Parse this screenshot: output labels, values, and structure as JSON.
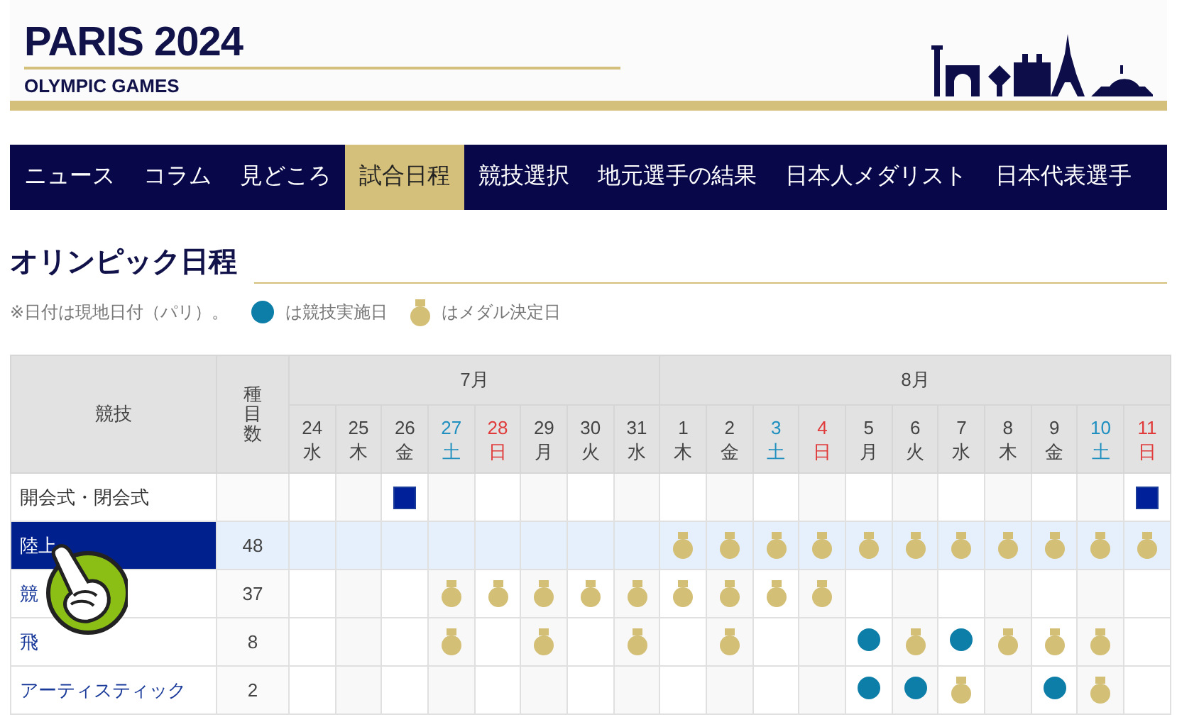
{
  "logo": {
    "title": "PARIS 2024",
    "subtitle": "OLYMPIC GAMES"
  },
  "nav": [
    {
      "label": "ニュース",
      "selected": false
    },
    {
      "label": "コラム",
      "selected": false
    },
    {
      "label": "見どころ",
      "selected": false
    },
    {
      "label": "試合日程",
      "selected": true
    },
    {
      "label": "競技選択",
      "selected": false
    },
    {
      "label": "地元選手の結果",
      "selected": false
    },
    {
      "label": "日本人メダリスト",
      "selected": false
    },
    {
      "label": "日本代表選手",
      "selected": false
    }
  ],
  "heading": "オリンピック日程",
  "legend": {
    "note": "※日付は現地日付（パリ）。",
    "dot_label": "は競技実施日",
    "medal_label": "はメダル決定日"
  },
  "table": {
    "sport_header": "競技",
    "count_header": "種目数",
    "months": [
      {
        "label": "7月",
        "days": [
          {
            "date": "24",
            "weekday": "水",
            "kind": "weekday"
          },
          {
            "date": "25",
            "weekday": "木",
            "kind": "weekday"
          },
          {
            "date": "26",
            "weekday": "金",
            "kind": "weekday"
          },
          {
            "date": "27",
            "weekday": "土",
            "kind": "saturday"
          },
          {
            "date": "28",
            "weekday": "日",
            "kind": "sunday"
          },
          {
            "date": "29",
            "weekday": "月",
            "kind": "weekday"
          },
          {
            "date": "30",
            "weekday": "火",
            "kind": "weekday"
          },
          {
            "date": "31",
            "weekday": "水",
            "kind": "weekday"
          }
        ]
      },
      {
        "label": "8月",
        "days": [
          {
            "date": "1",
            "weekday": "木",
            "kind": "weekday"
          },
          {
            "date": "2",
            "weekday": "金",
            "kind": "weekday"
          },
          {
            "date": "3",
            "weekday": "土",
            "kind": "saturday"
          },
          {
            "date": "4",
            "weekday": "日",
            "kind": "sunday"
          },
          {
            "date": "5",
            "weekday": "月",
            "kind": "weekday"
          },
          {
            "date": "6",
            "weekday": "火",
            "kind": "weekday"
          },
          {
            "date": "7",
            "weekday": "水",
            "kind": "weekday"
          },
          {
            "date": "8",
            "weekday": "木",
            "kind": "weekday"
          },
          {
            "date": "9",
            "weekday": "金",
            "kind": "weekday"
          },
          {
            "date": "10",
            "weekday": "土",
            "kind": "saturday"
          },
          {
            "date": "11",
            "weekday": "日",
            "kind": "sunday"
          }
        ]
      }
    ],
    "rows": [
      {
        "sport": "開会式・閉会式",
        "link": false,
        "selected": false,
        "cells": [
          {
            "kind": "empty"
          },
          {
            "kind": "empty"
          },
          {
            "kind": "ceremony"
          },
          {
            "kind": "empty"
          },
          {
            "kind": "empty"
          },
          {
            "kind": "empty"
          },
          {
            "kind": "empty"
          },
          {
            "kind": "empty"
          },
          {
            "kind": "empty"
          },
          {
            "kind": "empty"
          },
          {
            "kind": "empty"
          },
          {
            "kind": "empty"
          },
          {
            "kind": "empty"
          },
          {
            "kind": "empty"
          },
          {
            "kind": "empty"
          },
          {
            "kind": "empty"
          },
          {
            "kind": "empty"
          },
          {
            "kind": "empty"
          },
          {
            "kind": "ceremony"
          }
        ]
      },
      {
        "sport": "陸上",
        "count": "48",
        "link": true,
        "selected": true,
        "cells": [
          {
            "kind": "empty"
          },
          {
            "kind": "empty"
          },
          {
            "kind": "empty"
          },
          {
            "kind": "empty"
          },
          {
            "kind": "empty"
          },
          {
            "kind": "empty"
          },
          {
            "kind": "empty"
          },
          {
            "kind": "empty"
          },
          {
            "kind": "medal"
          },
          {
            "kind": "medal"
          },
          {
            "kind": "medal"
          },
          {
            "kind": "medal"
          },
          {
            "kind": "medal"
          },
          {
            "kind": "medal"
          },
          {
            "kind": "medal"
          },
          {
            "kind": "medal"
          },
          {
            "kind": "medal"
          },
          {
            "kind": "medal"
          },
          {
            "kind": "medal"
          }
        ]
      },
      {
        "sport": "競",
        "count": "37",
        "link": true,
        "selected": false,
        "cells": [
          {
            "kind": "empty"
          },
          {
            "kind": "empty"
          },
          {
            "kind": "empty"
          },
          {
            "kind": "medal"
          },
          {
            "kind": "medal"
          },
          {
            "kind": "medal"
          },
          {
            "kind": "medal"
          },
          {
            "kind": "medal"
          },
          {
            "kind": "medal"
          },
          {
            "kind": "medal"
          },
          {
            "kind": "medal"
          },
          {
            "kind": "medal"
          },
          {
            "kind": "empty"
          },
          {
            "kind": "empty"
          },
          {
            "kind": "empty"
          },
          {
            "kind": "empty"
          },
          {
            "kind": "empty"
          },
          {
            "kind": "empty"
          },
          {
            "kind": "empty"
          }
        ]
      },
      {
        "sport": "飛",
        "count": "8",
        "link": true,
        "selected": false,
        "cells": [
          {
            "kind": "empty"
          },
          {
            "kind": "empty"
          },
          {
            "kind": "empty"
          },
          {
            "kind": "medal"
          },
          {
            "kind": "empty"
          },
          {
            "kind": "medal"
          },
          {
            "kind": "empty"
          },
          {
            "kind": "medal"
          },
          {
            "kind": "empty"
          },
          {
            "kind": "medal"
          },
          {
            "kind": "empty"
          },
          {
            "kind": "empty"
          },
          {
            "kind": "event"
          },
          {
            "kind": "medal"
          },
          {
            "kind": "event"
          },
          {
            "kind": "medal"
          },
          {
            "kind": "medal"
          },
          {
            "kind": "medal"
          },
          {
            "kind": "empty"
          }
        ]
      },
      {
        "sport": "アーティスティック",
        "count": "2",
        "link": true,
        "selected": false,
        "cells": [
          {
            "kind": "empty"
          },
          {
            "kind": "empty"
          },
          {
            "kind": "empty"
          },
          {
            "kind": "empty"
          },
          {
            "kind": "empty"
          },
          {
            "kind": "empty"
          },
          {
            "kind": "empty"
          },
          {
            "kind": "empty"
          },
          {
            "kind": "empty"
          },
          {
            "kind": "empty"
          },
          {
            "kind": "empty"
          },
          {
            "kind": "empty"
          },
          {
            "kind": "event"
          },
          {
            "kind": "event"
          },
          {
            "kind": "medal"
          },
          {
            "kind": "empty"
          },
          {
            "kind": "event"
          },
          {
            "kind": "medal"
          },
          {
            "kind": "empty"
          }
        ]
      }
    ]
  }
}
